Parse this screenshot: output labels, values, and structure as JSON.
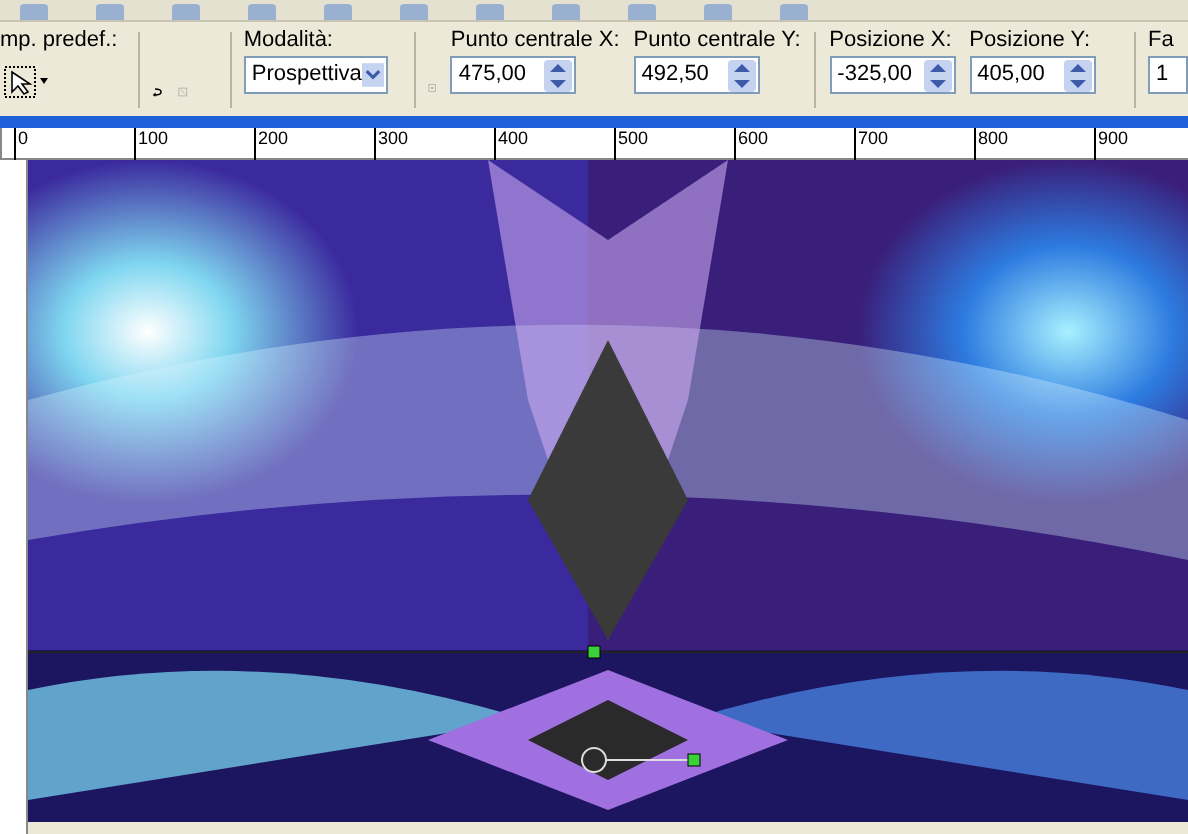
{
  "toolbar": {
    "preset_label": "mp. predef.:",
    "mode": {
      "label": "Modalità:",
      "value": "Prospettiva"
    },
    "fields": [
      {
        "label": "Punto centrale X:",
        "value": "475,00"
      },
      {
        "label": "Punto centrale Y:",
        "value": "492,50"
      },
      {
        "label": "Posizione X:",
        "value": "-325,00"
      },
      {
        "label": "Posizione Y:",
        "value": "405,00"
      },
      {
        "label": "Fa",
        "value": "1"
      }
    ]
  },
  "ruler": {
    "labels": [
      "0",
      "100",
      "200",
      "300",
      "400",
      "500",
      "600",
      "700",
      "800",
      "900"
    ]
  }
}
